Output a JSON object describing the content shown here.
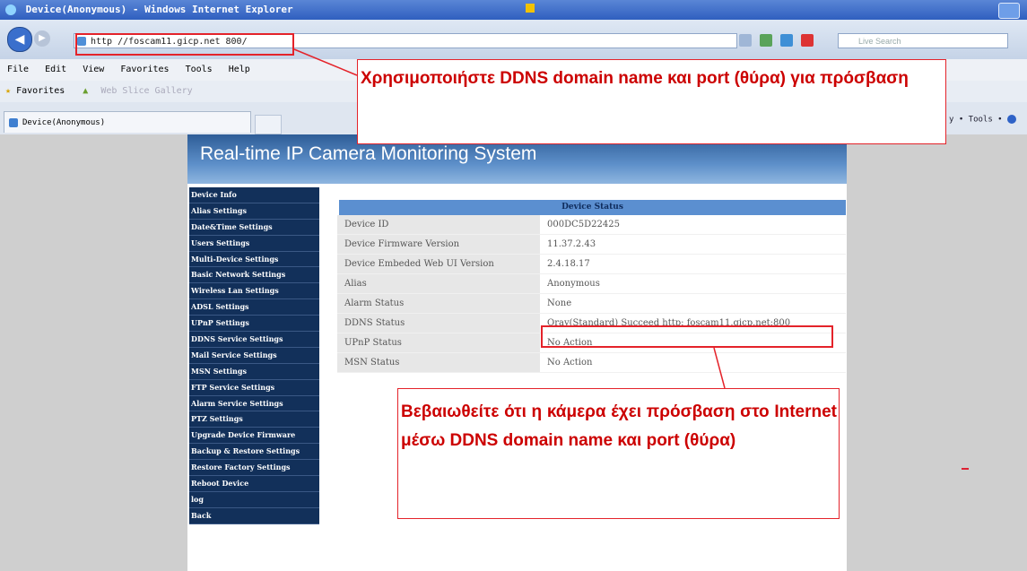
{
  "window": {
    "title": "Device(Anonymous) - Windows Internet Explorer"
  },
  "address_bar": {
    "url": "http //foscam11.gicp.net 800/",
    "search_placeholder": "Live Search"
  },
  "menu": {
    "items": [
      "File",
      "Edit",
      "View",
      "Favorites",
      "Tools",
      "Help"
    ]
  },
  "favorites_bar": {
    "label": "Favorites",
    "gallery": "Web Slice Gallery"
  },
  "tab": {
    "title": "Device(Anonymous)",
    "page_tools": "y •  Tools •"
  },
  "page": {
    "banner_title": "Real-time IP Camera Monitoring System",
    "sidebar": [
      "Device Info",
      "Alias Settings",
      "Date&Time Settings",
      "Users Settings",
      "Multi-Device Settings",
      "Basic Network Settings",
      "Wireless Lan Settings",
      "ADSL Settings",
      "UPnP Settings",
      "DDNS Service Settings",
      "Mail Service Settings",
      "MSN Settings",
      "FTP Service Settings",
      "Alarm Service Settings",
      "PTZ Settings",
      "Upgrade Device Firmware",
      "Backup & Restore Settings",
      "Restore Factory Settings",
      "Reboot Device",
      "log",
      "Back"
    ],
    "status_header": "Device Status",
    "status_rows": [
      {
        "label": "Device ID",
        "value": "000DC5D22425"
      },
      {
        "label": "Device Firmware Version",
        "value": "11.37.2.43"
      },
      {
        "label": "Device Embeded Web UI Version",
        "value": "2.4.18.17"
      },
      {
        "label": "Alias",
        "value": "Anonymous"
      },
      {
        "label": "Alarm Status",
        "value": "None"
      },
      {
        "label": "DDNS Status",
        "value": "Oray(Standard) Succeed  http: foscam11.gicp.net:800"
      },
      {
        "label": "UPnP Status",
        "value": "No Action"
      },
      {
        "label": "MSN Status",
        "value": "No Action"
      }
    ]
  },
  "annotations": {
    "callout_top": "Χρησιμοποιήστε DDNS domain name και port (θύρα) για πρόσβαση",
    "callout_bottom": "Βεβαιωθείτε ότι η κάμερα έχει πρόσβαση στο Internet μέσω DDNS domain name και port (θύρα)"
  },
  "colors": {
    "annotation_red": "#e4232a",
    "sidebar_navy": "#12305a",
    "header_blue": "#5b8fd0"
  }
}
